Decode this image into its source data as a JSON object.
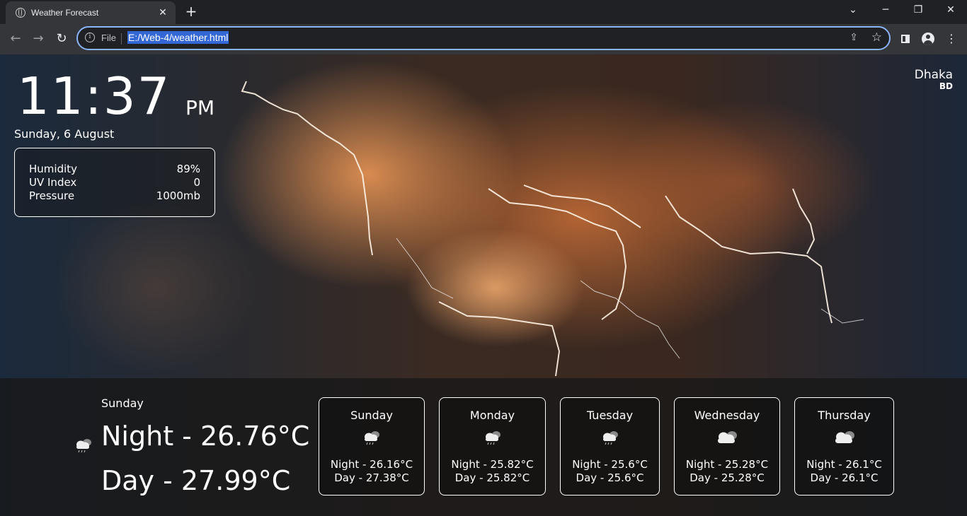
{
  "browser": {
    "tab_title": "Weather Forecast",
    "tab_close": "✕",
    "new_tab": "+",
    "scheme_label": "File",
    "url": "E:/Web-4/weather.html"
  },
  "clock": {
    "time": "11:37",
    "ampm": "PM",
    "date": "Sunday, 6 August"
  },
  "details": [
    {
      "label": "Humidity",
      "value": "89%"
    },
    {
      "label": "UV Index",
      "value": "0"
    },
    {
      "label": "Pressure",
      "value": "1000mb"
    }
  ],
  "location": {
    "city": "Dhaka",
    "country": "BD"
  },
  "today": {
    "day": "Sunday",
    "night": "Night - 26.76°C",
    "day_temp": "Day - 27.99°C",
    "icon": "cloud-rain-icon"
  },
  "forecast": [
    {
      "day": "Sunday",
      "night": "Night - 26.16°C",
      "day_temp": "Day - 27.38°C",
      "icon": "cloud-rain-icon"
    },
    {
      "day": "Monday",
      "night": "Night - 25.82°C",
      "day_temp": "Day - 25.82°C",
      "icon": "cloud-rain-icon"
    },
    {
      "day": "Tuesday",
      "night": "Night - 25.6°C",
      "day_temp": "Day - 25.6°C",
      "icon": "cloud-rain-icon"
    },
    {
      "day": "Wednesday",
      "night": "Night - 25.28°C",
      "day_temp": "Day - 25.28°C",
      "icon": "cloud-icon"
    },
    {
      "day": "Thursday",
      "night": "Night - 26.1°C",
      "day_temp": "Day - 26.1°C",
      "icon": "cloud-icon"
    }
  ],
  "colors": {
    "omnibox_focus": "#8ab4f8",
    "url_selection": "#3367d6"
  }
}
